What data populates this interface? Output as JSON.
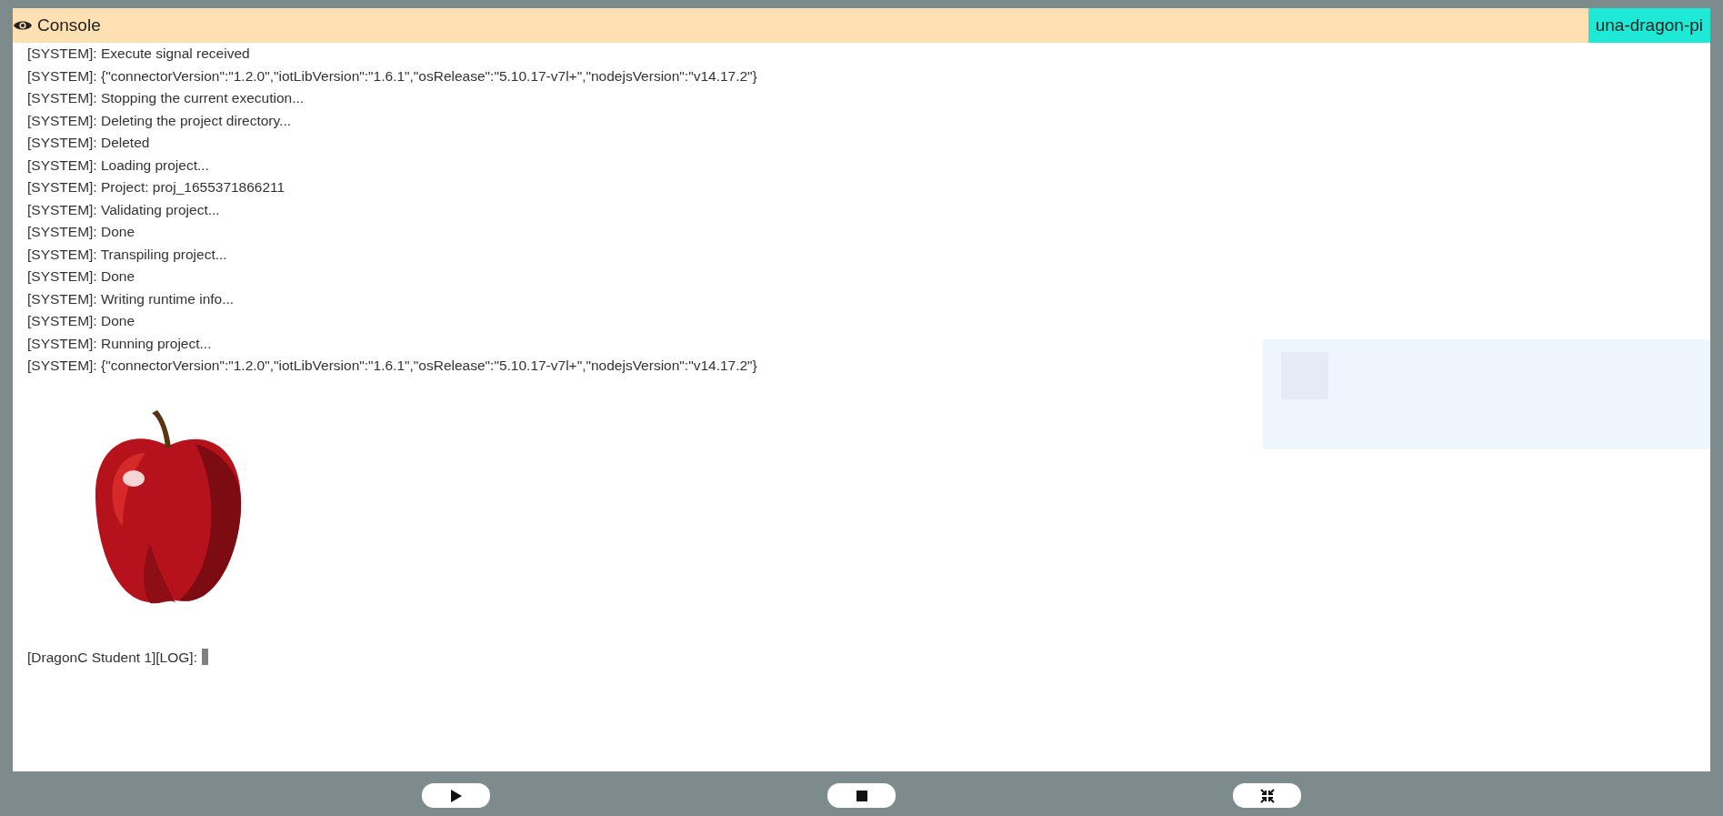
{
  "console": {
    "title": "Console",
    "device": "una-dragon-pi",
    "lines": [
      "[SYSTEM]: Execute signal received",
      "[SYSTEM]: {\"connectorVersion\":\"1.2.0\",\"iotLibVersion\":\"1.6.1\",\"osRelease\":\"5.10.17-v7l+\",\"nodejsVersion\":\"v14.17.2\"}",
      "[SYSTEM]: Stopping the current execution...",
      "[SYSTEM]: Deleting the project directory...",
      "[SYSTEM]: Deleted",
      "[SYSTEM]: Loading project...",
      "[SYSTEM]: Project: proj_1655371866211",
      "[SYSTEM]: Validating project...",
      "[SYSTEM]: Done",
      "[SYSTEM]: Transpiling project...",
      "[SYSTEM]: Done",
      "[SYSTEM]: Writing runtime info...",
      "[SYSTEM]: Done",
      "[SYSTEM]: Running project...",
      "[SYSTEM]: {\"connectorVersion\":\"1.2.0\",\"iotLibVersion\":\"1.6.1\",\"osRelease\":\"5.10.17-v7l+\",\"nodejsVersion\":\"v14.17.2\"}"
    ],
    "prompt": "[DragonC Student 1][LOG]:"
  },
  "controls": [
    {
      "kind": "play"
    },
    {
      "kind": "stop"
    },
    {
      "kind": "collapse"
    }
  ]
}
